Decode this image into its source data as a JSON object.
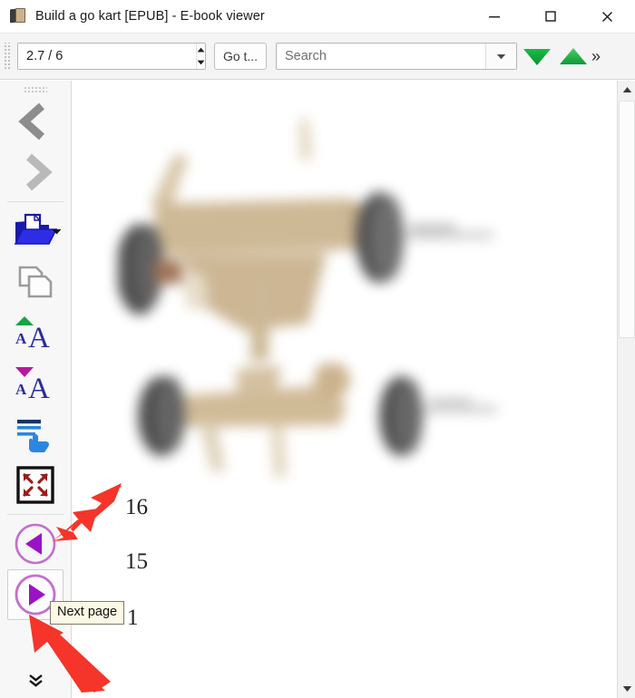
{
  "window": {
    "title": "Build a go kart [EPUB] - E-book viewer",
    "icon": "book-icon",
    "controls": {
      "minimize": "minimize-icon",
      "maximize": "maximize-icon",
      "close": "close-icon"
    }
  },
  "toolbar": {
    "position_value": "2.7 / 6",
    "position_placeholder": "2.7 / 6",
    "goto_label": "Go t...",
    "search_value": "",
    "search_placeholder": "Search",
    "search_dropdown_icon": "chevron-down-icon",
    "find_next_icon": "triangle-down-icon",
    "find_previous_icon": "triangle-up-icon",
    "overflow_label": "»",
    "accent_green": "#2db34a",
    "spin_up_icon": "spinner-up-icon",
    "spin_down_icon": "spinner-down-icon"
  },
  "sidebar": {
    "items": [
      {
        "name": "back-button",
        "icon": "chevron-left-icon",
        "label": "Back"
      },
      {
        "name": "forward-button",
        "icon": "chevron-right-icon",
        "label": "Forward"
      },
      {
        "name": "open-book-button",
        "icon": "open-folder-icon",
        "label": "Open book"
      },
      {
        "name": "copy-button",
        "icon": "copy-pages-icon",
        "label": "Copy"
      },
      {
        "name": "increase-font-button",
        "icon": "font-increase-icon",
        "label": "Increase font size"
      },
      {
        "name": "decrease-font-button",
        "icon": "font-decrease-icon",
        "label": "Decrease font size"
      },
      {
        "name": "toggle-paged-mode-button",
        "icon": "paged-mode-icon",
        "label": "Toggle paged mode"
      },
      {
        "name": "fullscreen-button",
        "icon": "fullscreen-arrows-icon",
        "label": "Toggle full screen"
      },
      {
        "name": "previous-page-button",
        "icon": "previous-page-icon",
        "label": "Previous page"
      },
      {
        "name": "next-page-button",
        "icon": "next-page-icon",
        "label": "Next page"
      }
    ],
    "overflow_icon": "double-chevron-down-icon",
    "grip_icon": "drag-grip-icon"
  },
  "tooltip": {
    "text": "Next page",
    "target": "next-page-button"
  },
  "content": {
    "figure_alt": "go-kart-chassis-photo",
    "page_numbers": [
      "16",
      "15",
      "1"
    ]
  },
  "scrollbar": {
    "up_icon": "scroll-up-icon",
    "down_icon": "scroll-down-icon"
  },
  "annotations": {
    "arrow_color": "#f5342a",
    "arrows": [
      {
        "name": "red-arrow-pointing-previous-page",
        "points_to": "previous-page-button"
      },
      {
        "name": "red-arrow-pointing-next-page",
        "points_to": "next-page-button"
      }
    ]
  }
}
